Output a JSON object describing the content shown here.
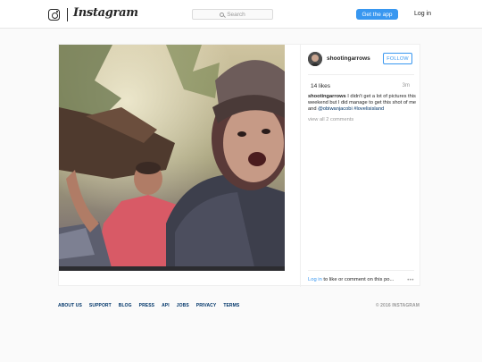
{
  "header": {
    "wordmark": "Instagram",
    "search_placeholder": "Search",
    "get_app_label": "Get the app",
    "login_label": "Log in"
  },
  "post": {
    "username": "shootingarrows",
    "follow_label": "FOLLOW",
    "likes": "14 likes",
    "time_ago": "3m",
    "caption": {
      "author": "shootingarrows",
      "text": " I didn't get a lot of pictures this weekend but I did manage to get this shot of me and ",
      "mention": "@obiwanjacobi",
      "space": " ",
      "hashtag": "#lovelisisland"
    },
    "view_all_comments": "view all 2 comments",
    "comment_prompt": {
      "login_link": "Log in",
      "rest": " to like or comment on this po..."
    },
    "more_icon": "more-options-icon"
  },
  "footer": {
    "links": [
      "ABOUT US",
      "SUPPORT",
      "BLOG",
      "PRESS",
      "API",
      "JOBS",
      "PRIVACY",
      "TERMS"
    ],
    "copyright": "© 2016 INSTAGRAM"
  },
  "colors": {
    "accent": "#3897f0",
    "link_dark": "#003569",
    "muted": "#999999",
    "background": "#fafafa"
  }
}
